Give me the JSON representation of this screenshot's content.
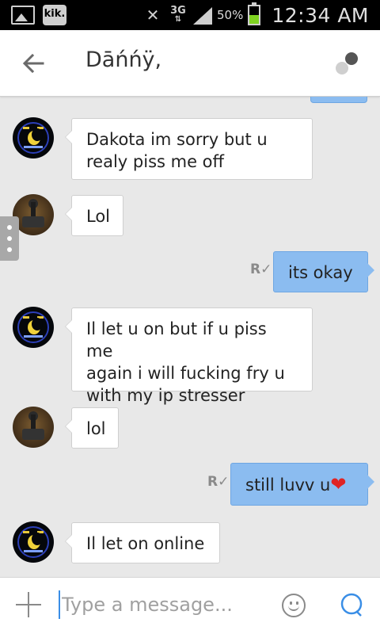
{
  "statusbar": {
    "network": "3G",
    "battery": "50%",
    "battery_level": 0.5,
    "time": "12:34 AM",
    "icons": [
      "gallery-icon",
      "kik-icon",
      "mute-icon",
      "network-icon",
      "signal-icon",
      "battery-icon"
    ],
    "kik_label": "kik."
  },
  "header": {
    "contact_name": "Dāńńÿ,",
    "back_icon": "arrow-left-icon",
    "menu_icon": "profile-dots-icon"
  },
  "messages": [
    {
      "side": "in",
      "avatar": "avatar-a",
      "text": "Dakota im sorry but u\nrealy piss me off"
    },
    {
      "side": "in",
      "avatar": "avatar-b",
      "text": "Lol"
    },
    {
      "side": "out",
      "receipt": "R",
      "text": "its okay"
    },
    {
      "side": "in",
      "avatar": "avatar-a",
      "text": "Il let u on but if u piss me\nagain i will fucking fry u\nwith my ip stresser"
    },
    {
      "side": "in",
      "avatar": "avatar-b",
      "text": "lol"
    },
    {
      "side": "out",
      "receipt": "R",
      "text": "still luvv u",
      "emoji": "❤"
    },
    {
      "side": "in",
      "avatar": "avatar-a",
      "text": "Il let on online"
    }
  ],
  "composer": {
    "placeholder": "Type a message...",
    "value": "",
    "add_icon": "plus-icon",
    "emoji_icon": "smiley-icon",
    "send_icon": "send-icon"
  },
  "colors": {
    "outgoing_bubble": "#8bbcf0",
    "incoming_bubble": "#ffffff",
    "chat_background": "#e8e8e8",
    "accent": "#3a8ee6"
  }
}
